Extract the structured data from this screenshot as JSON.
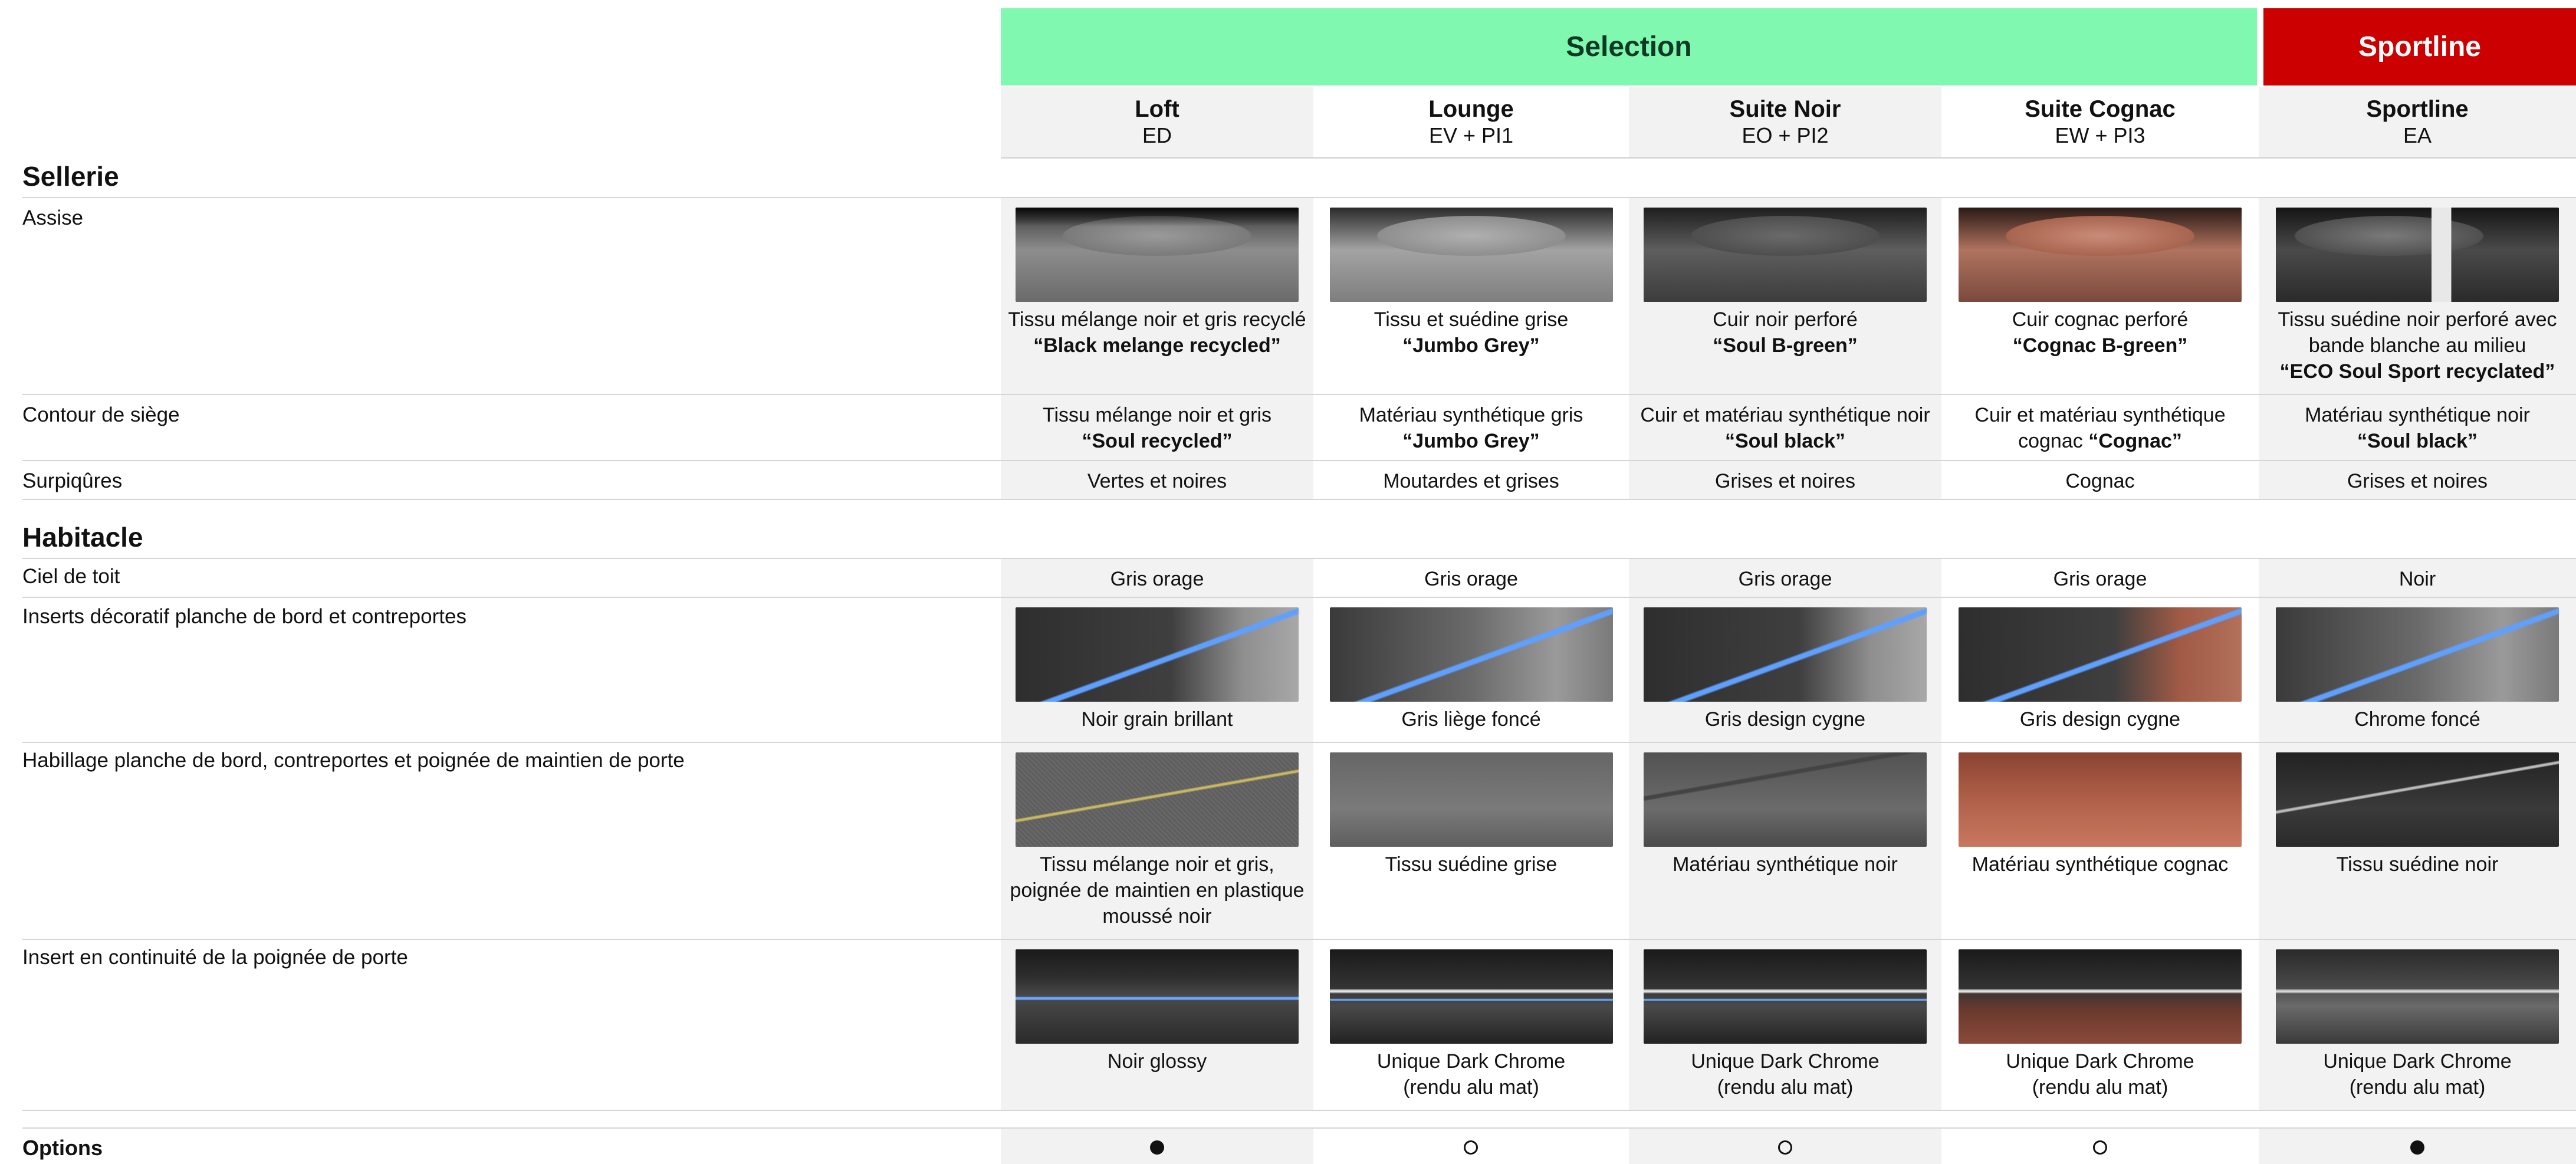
{
  "groups": {
    "selection": "Selection",
    "sportline": "Sportline"
  },
  "trims": [
    {
      "name": "Loft",
      "code": "ED"
    },
    {
      "name": "Lounge",
      "code": "EV + PI1"
    },
    {
      "name": "Suite Noir",
      "code": "EO + PI2"
    },
    {
      "name": "Suite Cognac",
      "code": "EW + PI3"
    },
    {
      "name": "Sportline",
      "code": "EA"
    }
  ],
  "sections": {
    "sellerie": "Sellerie",
    "habitacle": "Habitacle",
    "options": "Options"
  },
  "rows": {
    "assise": {
      "label": "Assise",
      "cells": [
        {
          "desc": "Tissu mélange noir et gris recyclé",
          "name": "“Black melange recycled”",
          "image": "seat-grey-fabric"
        },
        {
          "desc": "Tissu et suédine grise",
          "name": "“Jumbo Grey”",
          "image": "seat-grey-suede"
        },
        {
          "desc": "Cuir noir perforé",
          "name": "“Soul B-green”",
          "image": "seat-black-leather"
        },
        {
          "desc": "Cuir cognac perforé",
          "name": "“Cognac B-green”",
          "image": "seat-cognac-leather"
        },
        {
          "desc": "Tissu suédine noir perforé avec bande blanche au milieu",
          "name": "“ECO Soul Sport recyclated”",
          "image": "seat-sport-suede"
        }
      ]
    },
    "contour": {
      "label": "Contour de siège",
      "cells": [
        {
          "desc": "Tissu mélange noir et gris",
          "name": "“Soul recycled”"
        },
        {
          "desc": "Matériau synthétique gris",
          "name": "“Jumbo Grey”"
        },
        {
          "desc": "Cuir et matériau synthétique noir",
          "name": "“Soul black”"
        },
        {
          "desc": "Cuir et matériau synthétique cognac",
          "name": "“Cognac”"
        },
        {
          "desc": "Matériau synthétique noir",
          "name": "“Soul black”"
        }
      ]
    },
    "surpiqures": {
      "label": "Surpiqûres",
      "cells": [
        "Vertes et noires",
        "Moutardes et grises",
        "Grises et noires",
        "Cognac",
        "Grises et noires"
      ]
    },
    "ciel": {
      "label": "Ciel de toit",
      "cells": [
        "Gris orage",
        "Gris orage",
        "Gris orage",
        "Gris orage",
        "Noir"
      ]
    },
    "inserts": {
      "label": "Inserts décoratif planche de bord et contreportes",
      "cells": [
        "Noir grain brillant",
        "Gris liège foncé",
        "Gris design cygne",
        "Gris design cygne",
        "Chrome foncé"
      ]
    },
    "habillage": {
      "label": "Habillage planche de bord, contreportes et poignée de maintien de porte",
      "cells": [
        "Tissu mélange noir et gris, poignée de maintien en plastique moussé noir",
        "Tissu suédine grise",
        "Matériau synthétique noir",
        "Matériau synthétique cognac",
        "Tissu suédine noir"
      ]
    },
    "insert_poignee": {
      "label": "Insert en continuité de la poignée de porte",
      "cells": [
        {
          "line1": "Noir glossy",
          "line2": ""
        },
        {
          "line1": "Unique Dark Chrome",
          "line2": "(rendu alu mat)"
        },
        {
          "line1": "Unique Dark Chrome",
          "line2": "(rendu alu mat)"
        },
        {
          "line1": "Unique Dark Chrome",
          "line2": "(rendu alu mat)"
        },
        {
          "line1": "Unique Dark Chrome",
          "line2": "(rendu alu mat)"
        }
      ]
    }
  },
  "options": [
    "standard",
    "optional",
    "optional",
    "optional",
    "standard"
  ]
}
